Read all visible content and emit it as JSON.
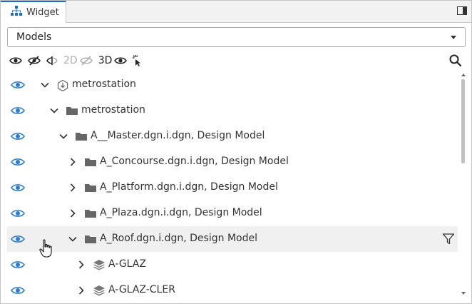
{
  "tab": {
    "label": "Widget",
    "icon": "hierarchy-icon"
  },
  "model_select": {
    "value": "Models"
  },
  "toolbar": {
    "label_2d": "2D",
    "label_3d": "3D"
  },
  "colors": {
    "accent": "#1b6ec2",
    "eye": "#2b7bd0",
    "folder": "#666666"
  },
  "tree": [
    {
      "label": "metrostation",
      "expanded": true,
      "icon": "subject-icon"
    },
    {
      "label": "metrostation",
      "expanded": true,
      "icon": "folder-icon"
    },
    {
      "label": "A__Master.dgn.i.dgn, Design Model",
      "expanded": true,
      "icon": "folder-icon"
    },
    {
      "label": "A_Concourse.dgn.i.dgn, Design Model",
      "expanded": false,
      "icon": "folder-icon"
    },
    {
      "label": "A_Platform.dgn.i.dgn, Design Model",
      "expanded": false,
      "icon": "folder-icon"
    },
    {
      "label": "A_Plaza.dgn.i.dgn, Design Model",
      "expanded": false,
      "icon": "folder-icon"
    },
    {
      "label": "A_Roof.dgn.i.dgn, Design Model",
      "expanded": true,
      "icon": "folder-icon"
    },
    {
      "label": "A-GLAZ",
      "expanded": false,
      "icon": "layers-icon"
    },
    {
      "label": "A-GLAZ-CLER",
      "expanded": false,
      "icon": "layers-icon"
    }
  ]
}
